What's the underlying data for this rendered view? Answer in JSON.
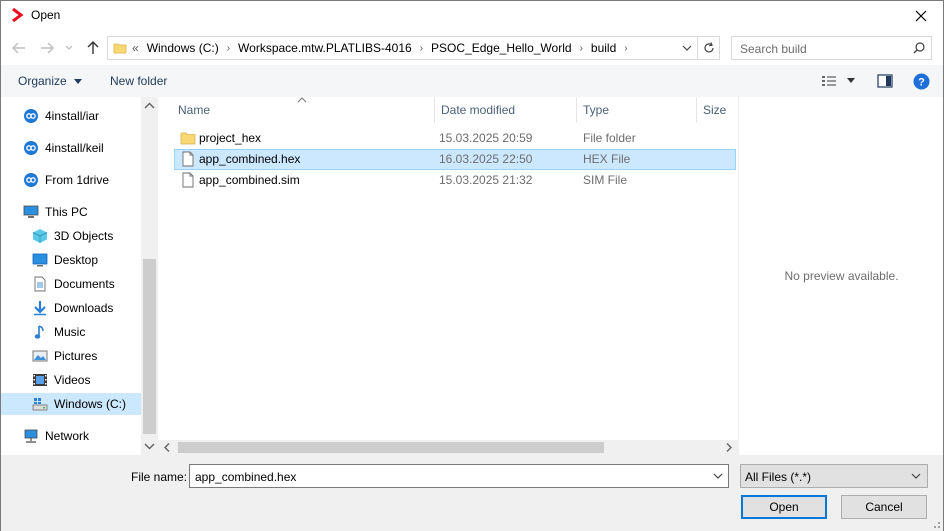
{
  "window": {
    "title": "Open",
    "close_icon": "close-icon"
  },
  "address": {
    "overflow": "«",
    "crumbs": [
      "Windows (C:)",
      "Workspace.mtw.PLATLIBS-4016",
      "PSOC_Edge_Hello_World",
      "build"
    ]
  },
  "search": {
    "placeholder": "Search build"
  },
  "toolbar": {
    "organize": "Organize",
    "new_folder": "New folder"
  },
  "nav": {
    "items": [
      {
        "label": "4install/iar",
        "icon": "cloud-drive-icon"
      },
      {
        "label": "4install/keil",
        "icon": "cloud-drive-icon"
      },
      {
        "label": "From 1drive",
        "icon": "cloud-drive-icon"
      },
      {
        "label": "This PC",
        "icon": "computer-icon"
      },
      {
        "label": "3D Objects",
        "icon": "3d-objects-icon"
      },
      {
        "label": "Desktop",
        "icon": "desktop-icon"
      },
      {
        "label": "Documents",
        "icon": "documents-icon"
      },
      {
        "label": "Downloads",
        "icon": "downloads-icon"
      },
      {
        "label": "Music",
        "icon": "music-icon"
      },
      {
        "label": "Pictures",
        "icon": "pictures-icon"
      },
      {
        "label": "Videos",
        "icon": "videos-icon"
      },
      {
        "label": "Windows (C:)",
        "icon": "drive-icon"
      },
      {
        "label": "Network",
        "icon": "network-icon"
      }
    ]
  },
  "columns": {
    "name": "Name",
    "date": "Date modified",
    "type": "Type",
    "size": "Size"
  },
  "files": [
    {
      "name": "project_hex",
      "date": "15.03.2025 20:59",
      "type": "File folder",
      "icon": "folder-icon"
    },
    {
      "name": "app_combined.hex",
      "date": "16.03.2025 22:50",
      "type": "HEX File",
      "icon": "file-icon"
    },
    {
      "name": "app_combined.sim",
      "date": "15.03.2025 21:32",
      "type": "SIM File",
      "icon": "file-icon"
    }
  ],
  "preview": {
    "text": "No preview available."
  },
  "bottom": {
    "file_name_label": "File name:",
    "file_name_value": "app_combined.hex",
    "filter_value": "All Files (*.*)",
    "open_label": "Open",
    "cancel_label": "Cancel"
  },
  "colors": {
    "selection": "#cce8ff",
    "accent": "#0078d7",
    "app_icon": "#e81123"
  }
}
